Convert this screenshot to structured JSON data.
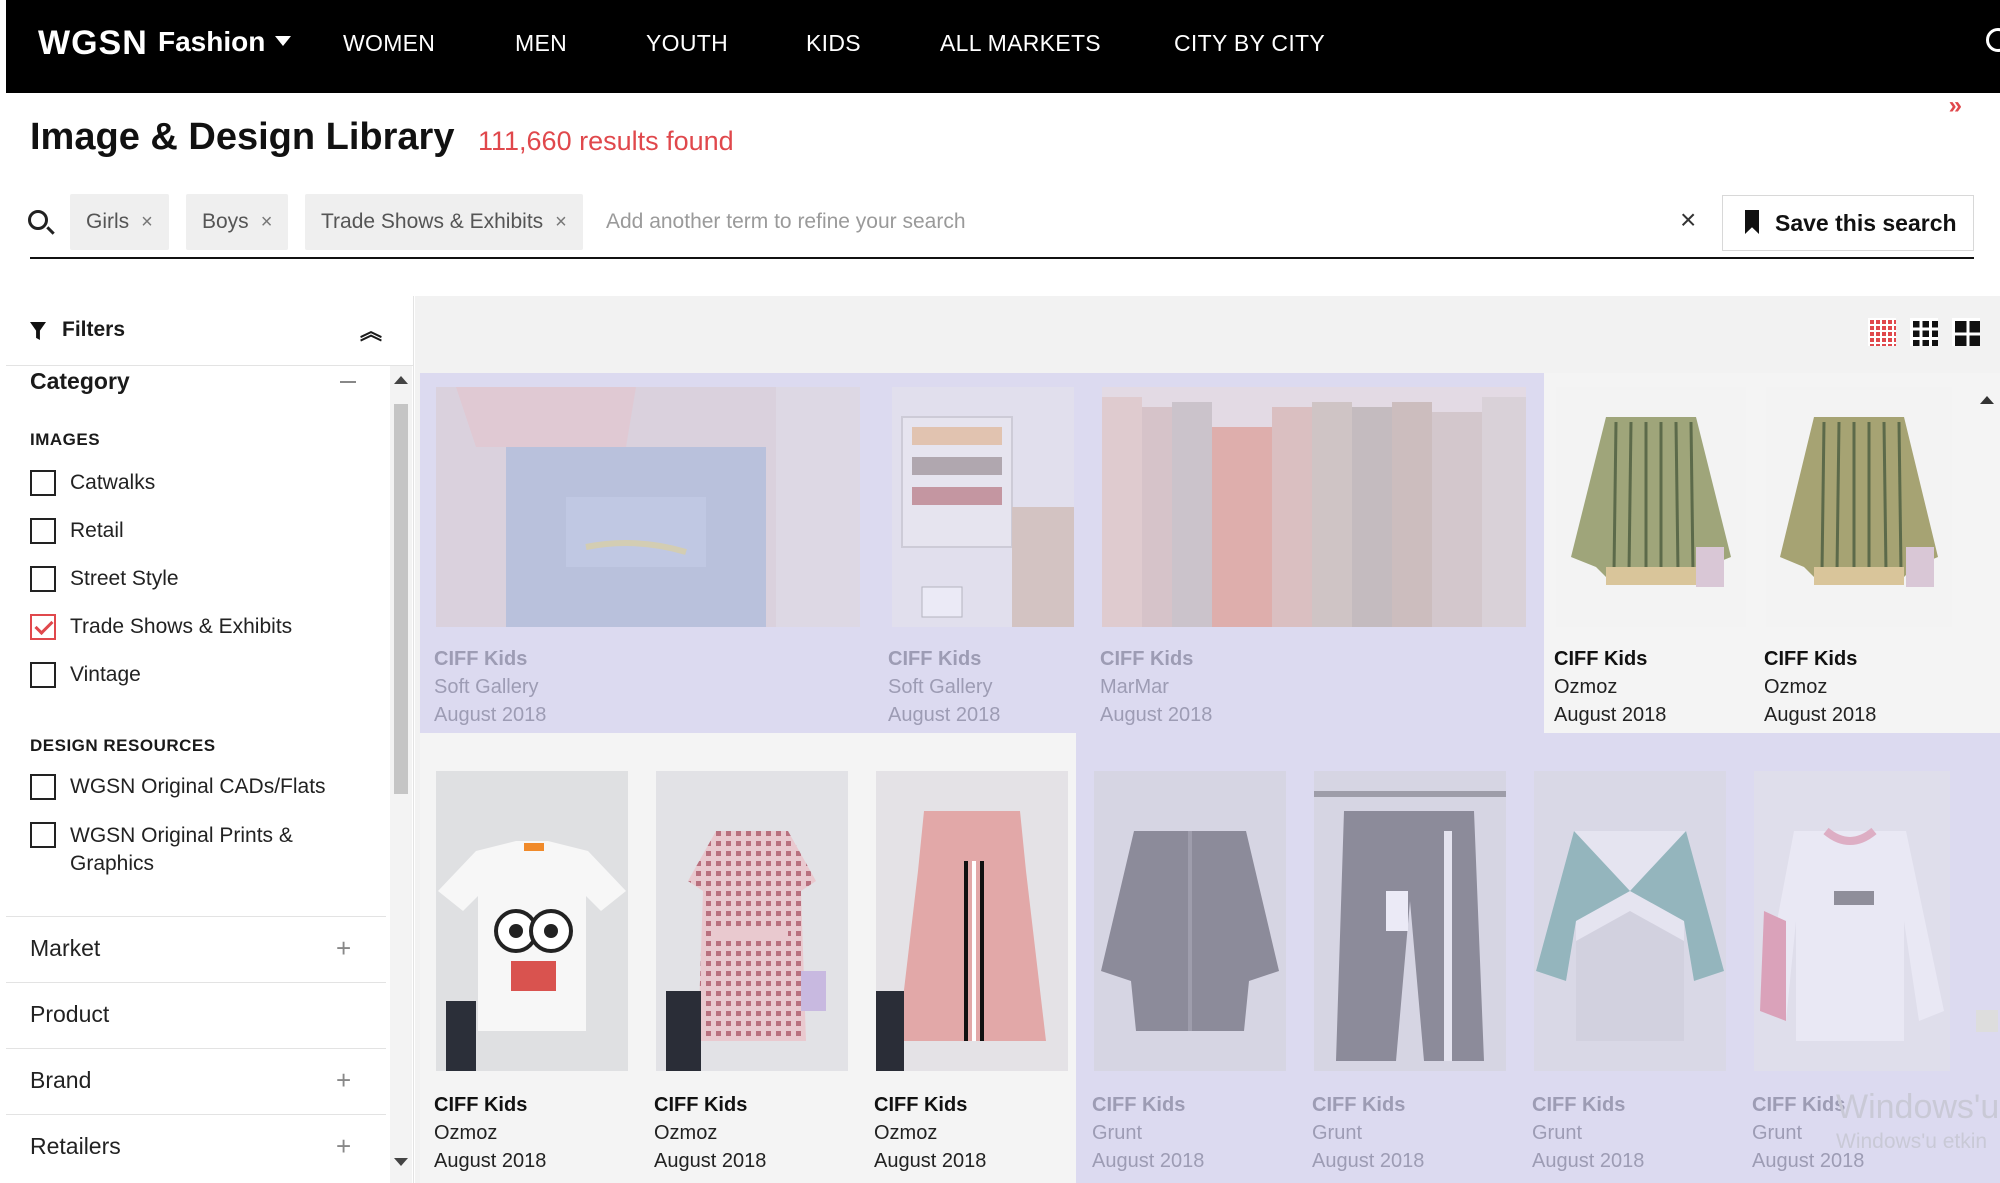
{
  "nav": {
    "logo": "WGSN",
    "section": "Fashion",
    "items": [
      "WOMEN",
      "MEN",
      "YOUTH",
      "KIDS",
      "ALL MARKETS",
      "CITY BY CITY"
    ]
  },
  "header": {
    "title": "Image & Design Library",
    "results": "111,660 results found",
    "expand_glyph": "»"
  },
  "search": {
    "chips": [
      "Girls",
      "Boys",
      "Trade Shows & Exhibits"
    ],
    "chip_remove_glyph": "×",
    "placeholder": "Add another term to refine your search",
    "clear_glyph": "×",
    "save_label": "Save this search"
  },
  "sidebar": {
    "filters_label": "Filters",
    "collapse_glyph": "⌃",
    "category_title": "Category",
    "images_label": "IMAGES",
    "images_options": [
      {
        "label": "Catwalks",
        "checked": false
      },
      {
        "label": "Retail",
        "checked": false
      },
      {
        "label": "Street Style",
        "checked": false
      },
      {
        "label": "Trade Shows & Exhibits",
        "checked": true
      },
      {
        "label": "Vintage",
        "checked": false
      }
    ],
    "design_label": "DESIGN RESOURCES",
    "design_options": [
      {
        "label": "WGSN Original CADs/Flats",
        "checked": false
      },
      {
        "label": "WGSN Original Prints &",
        "label2": "Graphics",
        "checked": false
      }
    ],
    "accordions": [
      {
        "label": "Market",
        "plus": "+"
      },
      {
        "label": "Product",
        "plus": ""
      },
      {
        "label": "Brand",
        "plus": "+"
      },
      {
        "label": "Retailers",
        "plus": "+"
      }
    ]
  },
  "tiles": [
    {
      "title": "CIFF Kids",
      "sub": "Soft Gallery",
      "date": "August 2018"
    },
    {
      "title": "CIFF Kids",
      "sub": "Soft Gallery",
      "date": "August 2018"
    },
    {
      "title": "CIFF Kids",
      "sub": "MarMar",
      "date": "August 2018"
    },
    {
      "title": "CIFF Kids",
      "sub": "Ozmoz",
      "date": "August 2018"
    },
    {
      "title": "CIFF Kids",
      "sub": "Ozmoz",
      "date": "August 2018"
    },
    {
      "title": "CIFF Kids",
      "sub": "Ozmoz",
      "date": "August 2018"
    },
    {
      "title": "CIFF Kids",
      "sub": "Ozmoz",
      "date": "August 2018"
    },
    {
      "title": "CIFF Kids",
      "sub": "Ozmoz",
      "date": "August 2018"
    },
    {
      "title": "CIFF Kids",
      "sub": "Grunt",
      "date": "August 2018"
    },
    {
      "title": "CIFF Kids",
      "sub": "Grunt",
      "date": "August 2018"
    },
    {
      "title": "CIFF Kids",
      "sub": "Grunt",
      "date": "August 2018"
    },
    {
      "title": "CIFF Kids",
      "sub": "Grunt",
      "date": "August 2018"
    }
  ],
  "watermark": {
    "line1": "Windows'u",
    "line2": "Windows'u etkin"
  },
  "colors": {
    "accent": "#e0484c",
    "nav_bg": "#000000",
    "highlight": "#dcdaf0"
  }
}
